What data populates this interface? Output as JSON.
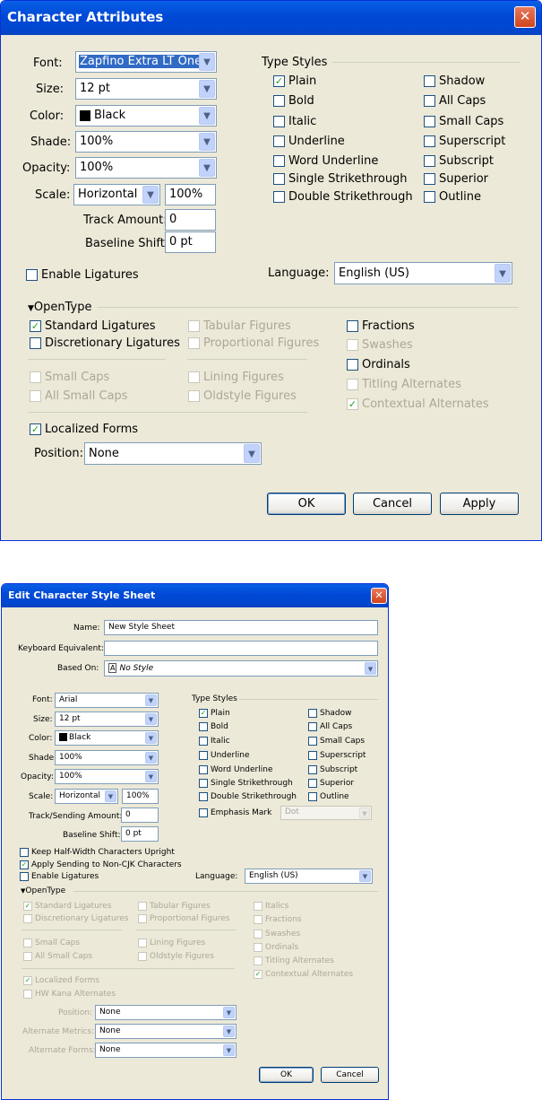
{
  "w1": {
    "title": "Character Attributes",
    "labels": {
      "font": "Font:",
      "size": "Size:",
      "color": "Color:",
      "shade": "Shade:",
      "opacity": "Opacity:",
      "scale": "Scale:",
      "track": "Track Amount:",
      "baseline": "Baseline Shift:",
      "language": "Language:",
      "position": "Position:"
    },
    "values": {
      "font": "Zapfino Extra LT One",
      "size": "12 pt",
      "color": "Black",
      "shade": "100%",
      "opacity": "100%",
      "scale_mode": "Horizontal",
      "scale_value": "100%",
      "track": "0",
      "baseline": "0 pt",
      "language": "English (US)",
      "position": "None"
    },
    "type_styles_heading": "Type Styles",
    "type_styles": [
      {
        "label": "Plain",
        "checked": true
      },
      {
        "label": "Bold",
        "checked": false
      },
      {
        "label": "Italic",
        "checked": false
      },
      {
        "label": "Underline",
        "checked": false
      },
      {
        "label": "Word Underline",
        "checked": false
      },
      {
        "label": "Single Strikethrough",
        "checked": false
      },
      {
        "label": "Double Strikethrough",
        "checked": false
      },
      {
        "label": "Shadow",
        "checked": false
      },
      {
        "label": "All Caps",
        "checked": false
      },
      {
        "label": "Small Caps",
        "checked": false
      },
      {
        "label": "Superscript",
        "checked": false
      },
      {
        "label": "Subscript",
        "checked": false
      },
      {
        "label": "Superior",
        "checked": false
      },
      {
        "label": "Outline",
        "checked": false
      }
    ],
    "enable_ligatures": "Enable Ligatures",
    "opentype_heading": "OpenType",
    "opentype": [
      {
        "label": "Standard Ligatures",
        "checked": true,
        "enabled": true
      },
      {
        "label": "Discretionary Ligatures",
        "checked": false,
        "enabled": true
      },
      {
        "label": "Small Caps",
        "checked": false,
        "enabled": false
      },
      {
        "label": "All Small Caps",
        "checked": false,
        "enabled": false
      },
      {
        "label": "Tabular Figures",
        "checked": false,
        "enabled": false
      },
      {
        "label": "Proportional Figures",
        "checked": false,
        "enabled": false
      },
      {
        "label": "Lining Figures",
        "checked": false,
        "enabled": false
      },
      {
        "label": "Oldstyle Figures",
        "checked": false,
        "enabled": false
      },
      {
        "label": "Fractions",
        "checked": false,
        "enabled": true
      },
      {
        "label": "Swashes",
        "checked": false,
        "enabled": false
      },
      {
        "label": "Ordinals",
        "checked": false,
        "enabled": true
      },
      {
        "label": "Titling Alternates",
        "checked": false,
        "enabled": false
      },
      {
        "label": "Contextual Alternates",
        "checked": true,
        "enabled": false
      }
    ],
    "localized_forms": "Localized Forms",
    "buttons": {
      "ok": "OK",
      "cancel": "Cancel",
      "apply": "Apply"
    }
  },
  "w2": {
    "title": "Edit Character Style Sheet",
    "labels": {
      "name": "Name:",
      "keyboard": "Keyboard Equivalent:",
      "based_on": "Based On:",
      "font": "Font:",
      "size": "Size:",
      "color": "Color:",
      "shade": "Shade:",
      "opacity": "Opacity:",
      "scale": "Scale:",
      "track": "Track/Sending Amount:",
      "baseline": "Baseline Shift:",
      "language": "Language:",
      "position": "Position:",
      "alt_metrics": "Alternate Metrics:",
      "alt_forms": "Alternate Forms:"
    },
    "values": {
      "name": "New Style Sheet",
      "keyboard": "",
      "based_on_glyph": "A",
      "based_on": "No Style",
      "font": "Arial",
      "size": "12 pt",
      "color": "Black",
      "shade": "100%",
      "opacity": "100%",
      "scale_mode": "Horizontal",
      "scale_value": "100%",
      "track": "0",
      "baseline": "0 pt",
      "emphasis": "Dot",
      "language": "English (US)",
      "position": "None",
      "alt_metrics": "None",
      "alt_forms": "None"
    },
    "type_styles_heading": "Type Styles",
    "type_styles": [
      {
        "label": "Plain",
        "checked": true
      },
      {
        "label": "Bold",
        "checked": false
      },
      {
        "label": "Italic",
        "checked": false
      },
      {
        "label": "Underline",
        "checked": false
      },
      {
        "label": "Word Underline",
        "checked": false
      },
      {
        "label": "Single Strikethrough",
        "checked": false
      },
      {
        "label": "Double Strikethrough",
        "checked": false
      },
      {
        "label": "Shadow",
        "checked": false
      },
      {
        "label": "All Caps",
        "checked": false
      },
      {
        "label": "Small Caps",
        "checked": false
      },
      {
        "label": "Superscript",
        "checked": false
      },
      {
        "label": "Subscript",
        "checked": false
      },
      {
        "label": "Superior",
        "checked": false
      },
      {
        "label": "Outline",
        "checked": false
      }
    ],
    "emphasis_mark": "Emphasis Mark",
    "keep_half_width": "Keep Half-Width Characters Upright",
    "apply_sending": "Apply Sending to Non-CJK Characters",
    "enable_ligatures": "Enable Ligatures",
    "opentype_heading": "OpenType",
    "opentype": [
      {
        "label": "Standard Ligatures",
        "checked": true,
        "enabled": false
      },
      {
        "label": "Discretionary Ligatures",
        "checked": false,
        "enabled": false
      },
      {
        "label": "Small Caps",
        "checked": false,
        "enabled": false
      },
      {
        "label": "All Small Caps",
        "checked": false,
        "enabled": false
      },
      {
        "label": "Tabular Figures",
        "checked": false,
        "enabled": false
      },
      {
        "label": "Proportional Figures",
        "checked": false,
        "enabled": false
      },
      {
        "label": "Lining Figures",
        "checked": false,
        "enabled": false
      },
      {
        "label": "Oldstyle Figures",
        "checked": false,
        "enabled": false
      },
      {
        "label": "Italics",
        "checked": false,
        "enabled": false
      },
      {
        "label": "Fractions",
        "checked": false,
        "enabled": false
      },
      {
        "label": "Swashes",
        "checked": false,
        "enabled": false
      },
      {
        "label": "Ordinals",
        "checked": false,
        "enabled": false
      },
      {
        "label": "Titling Alternates",
        "checked": false,
        "enabled": false
      },
      {
        "label": "Contextual Alternates",
        "checked": true,
        "enabled": false
      },
      {
        "label": "Localized Forms",
        "checked": true,
        "enabled": false
      },
      {
        "label": "HW Kana Alternates",
        "checked": false,
        "enabled": false
      }
    ],
    "buttons": {
      "ok": "OK",
      "cancel": "Cancel"
    }
  }
}
